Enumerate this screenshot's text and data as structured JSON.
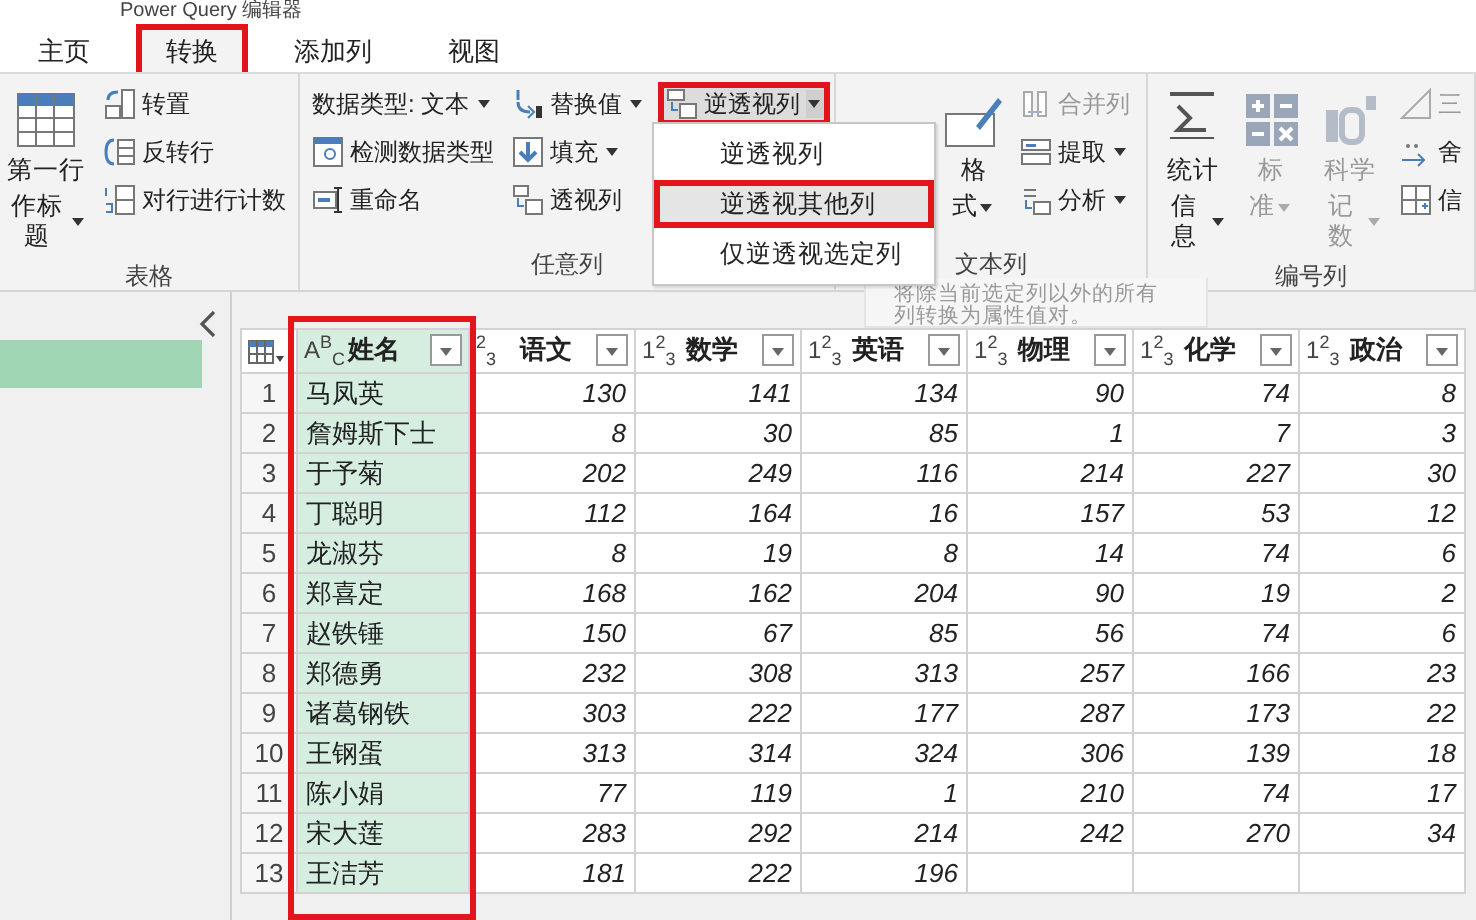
{
  "window": {
    "title": "Power Query 编辑器"
  },
  "tabs": [
    {
      "label": "主页",
      "selected": false,
      "highlighted": false
    },
    {
      "label": "转换",
      "selected": true,
      "highlighted": true
    },
    {
      "label": "添加列",
      "selected": false,
      "highlighted": false
    },
    {
      "label": "视图",
      "selected": false,
      "highlighted": false
    }
  ],
  "ribbon": {
    "groups": [
      {
        "label": "表格",
        "columns": [
          {
            "kind": "large",
            "lines": [
              "第一行",
              "作标题"
            ],
            "dropdown": true,
            "disabled": false
          },
          {
            "kind": "stack",
            "items": [
              {
                "label": "转置",
                "dropdown": false,
                "disabled": false,
                "highlighted": false,
                "expanded": false
              },
              {
                "label": "反转行",
                "dropdown": false,
                "disabled": false,
                "highlighted": false,
                "expanded": false
              },
              {
                "label": "对行进行计数",
                "dropdown": false,
                "disabled": false,
                "highlighted": false,
                "expanded": false
              }
            ]
          }
        ]
      },
      {
        "label": "任意列",
        "columns": [
          {
            "kind": "stack",
            "items": [
              {
                "label": "数据类型: 文本",
                "dropdown": true,
                "disabled": false,
                "highlighted": false,
                "expanded": false
              },
              {
                "label": "检测数据类型",
                "dropdown": false,
                "disabled": false,
                "highlighted": false,
                "expanded": false
              },
              {
                "label": "重命名",
                "dropdown": false,
                "disabled": false,
                "highlighted": false,
                "expanded": false
              }
            ]
          },
          {
            "kind": "stack",
            "items": [
              {
                "label": "替换值",
                "dropdown": true,
                "disabled": false,
                "highlighted": false,
                "expanded": false
              },
              {
                "label": "填充",
                "dropdown": true,
                "disabled": false,
                "highlighted": false,
                "expanded": false
              },
              {
                "label": "透视列",
                "dropdown": false,
                "disabled": false,
                "highlighted": false,
                "expanded": false
              }
            ]
          },
          {
            "kind": "stack",
            "items": [
              {
                "label": "逆透视列",
                "dropdown": true,
                "disabled": false,
                "highlighted": true,
                "expanded": true
              }
            ]
          }
        ]
      },
      {
        "label": "文本列",
        "columns": [
          {
            "kind": "large",
            "lines": [
              "格",
              "式"
            ],
            "dropdown": true,
            "disabled": false
          },
          {
            "kind": "stack",
            "items": [
              {
                "label": "合并列",
                "dropdown": false,
                "disabled": true,
                "highlighted": false,
                "expanded": false
              },
              {
                "label": "提取",
                "dropdown": true,
                "disabled": false,
                "highlighted": false,
                "expanded": false
              },
              {
                "label": "分析",
                "dropdown": true,
                "disabled": false,
                "highlighted": false,
                "expanded": false
              }
            ]
          }
        ]
      },
      {
        "label": "编号列",
        "columns": [
          {
            "kind": "large",
            "lines": [
              "统计",
              "信息"
            ],
            "dropdown": true,
            "disabled": false
          },
          {
            "kind": "large",
            "lines": [
              "标",
              "准"
            ],
            "dropdown": true,
            "disabled": true
          },
          {
            "kind": "large",
            "lines": [
              "科学",
              "记数"
            ],
            "dropdown": true,
            "disabled": true
          },
          {
            "kind": "stack",
            "items": [
              {
                "label": "三",
                "dropdown": false,
                "disabled": true,
                "highlighted": false,
                "expanded": false
              },
              {
                "label": "舍",
                "dropdown": false,
                "disabled": false,
                "highlighted": false,
                "expanded": false
              },
              {
                "label": "信",
                "dropdown": false,
                "disabled": false,
                "highlighted": false,
                "expanded": false
              }
            ]
          }
        ]
      }
    ]
  },
  "menu": {
    "items": [
      {
        "label": "逆透视列",
        "selected": false,
        "highlighted": false
      },
      {
        "label": "逆透视其他列",
        "selected": true,
        "highlighted": true
      },
      {
        "label": "仅逆透视选定列",
        "selected": false,
        "highlighted": false
      }
    ]
  },
  "tooltip": {
    "lines": [
      "将除当前选定列以外的所有",
      "列转换为属性值对。"
    ]
  },
  "queries": [
    {
      "selected": true
    }
  ],
  "table": {
    "columns": [
      {
        "name": "姓名",
        "type": "A$^{B}$$_{C}$",
        "kind": "text",
        "selected": true,
        "highlighted": true
      },
      {
        "name": "语文",
        "type": "$^{2}$$_{3}$",
        "kind": "number",
        "selected": false,
        "highlighted": false
      },
      {
        "name": "数学",
        "type": "1$^{2}$$_{3}$",
        "kind": "number",
        "selected": false,
        "highlighted": false
      },
      {
        "name": "英语",
        "type": "1$^{2}$$_{3}$",
        "kind": "number",
        "selected": false,
        "highlighted": false
      },
      {
        "name": "物理",
        "type": "1$^{2}$$_{3}$",
        "kind": "number",
        "selected": false,
        "highlighted": false
      },
      {
        "name": "化学",
        "type": "1$^{2}$$_{3}$",
        "kind": "number",
        "selected": false,
        "highlighted": false
      },
      {
        "name": "政治",
        "type": "1$^{2}$$_{3}$",
        "kind": "number",
        "selected": false,
        "highlighted": false
      }
    ],
    "rows": [
      {
        "index": "1",
        "cells": [
          "马凤英",
          "130",
          "141",
          "134",
          "90",
          "74",
          "8"
        ]
      },
      {
        "index": "2",
        "cells": [
          "詹姆斯下士",
          "8",
          "30",
          "85",
          "1",
          "7",
          "3"
        ]
      },
      {
        "index": "3",
        "cells": [
          "于予菊",
          "202",
          "249",
          "116",
          "214",
          "227",
          "30"
        ]
      },
      {
        "index": "4",
        "cells": [
          "丁聪明",
          "112",
          "164",
          "16",
          "157",
          "53",
          "12"
        ]
      },
      {
        "index": "5",
        "cells": [
          "龙淑芬",
          "8",
          "19",
          "8",
          "14",
          "74",
          "6"
        ]
      },
      {
        "index": "6",
        "cells": [
          "郑喜定",
          "168",
          "162",
          "204",
          "90",
          "19",
          "2"
        ]
      },
      {
        "index": "7",
        "cells": [
          "赵铁锤",
          "150",
          "67",
          "85",
          "56",
          "74",
          "6"
        ]
      },
      {
        "index": "8",
        "cells": [
          "郑德勇",
          "232",
          "308",
          "313",
          "257",
          "166",
          "23"
        ]
      },
      {
        "index": "9",
        "cells": [
          "诸葛钢铁",
          "303",
          "222",
          "177",
          "287",
          "173",
          "22"
        ]
      },
      {
        "index": "10",
        "cells": [
          "王钢蛋",
          "313",
          "314",
          "324",
          "306",
          "139",
          "18"
        ]
      },
      {
        "index": "11",
        "cells": [
          "陈小娟",
          "77",
          "119",
          "1",
          "210",
          "74",
          "17"
        ]
      },
      {
        "index": "12",
        "cells": [
          "宋大莲",
          "283",
          "292",
          "214",
          "242",
          "270",
          "34"
        ]
      },
      {
        "index": "13",
        "cells": [
          "王洁芳",
          "181",
          "222",
          "196",
          null,
          null,
          null
        ]
      }
    ]
  }
}
